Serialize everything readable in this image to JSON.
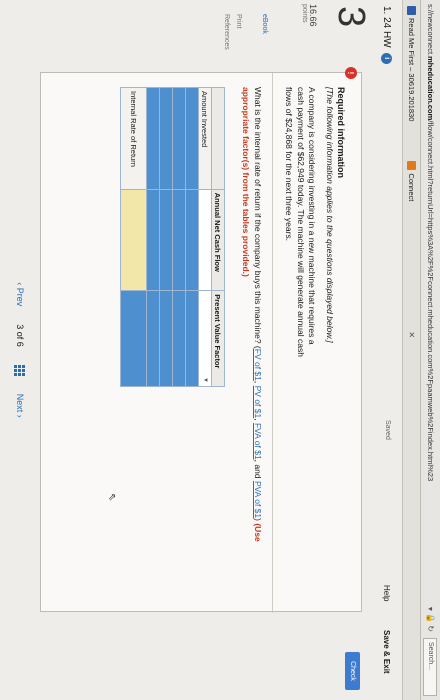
{
  "browser": {
    "url_host": "mheducation.com",
    "url_prefix": "s://newconnect.",
    "url_rest": "/flow/connect.html?returnUrl=https%3A%2F%2Fconnect.mheducation.com%2Fpaamweb%2Findex.html%23 ",
    "search_placeholder": "Search...",
    "bookmarks": [
      {
        "label": "Read Me First – 30619.201830",
        "icon": "book-icon",
        "color": "#2f5da8"
      },
      {
        "label": "Connect",
        "icon": "connect-icon",
        "color": "#e07a1f"
      }
    ]
  },
  "header": {
    "title": "1. 24 HW",
    "saved": "Saved",
    "help": "Help",
    "save_exit": "Save & Exit",
    "check": "Check"
  },
  "rail": {
    "question_number": "3",
    "points_value": "16.66",
    "points_label": "points",
    "links": [
      "eBook",
      "Print",
      "References"
    ]
  },
  "content": {
    "required_title": "Required information",
    "required_note": "[The following information applies to the questions displayed below.]",
    "required_body": "A company is considering investing in a new machine that requires a cash payment of $62,949 today. The machine will generate annual cash flows of $24,868 for the next three years.",
    "question_text": "What is the internal rate of return if the company buys this machine?",
    "links": [
      "FV of $1",
      "PV of $1",
      "FVA of $1",
      "PVA of $1"
    ],
    "instruction": "(Use appropriate factor(s) from the tables provided.)"
  },
  "table": {
    "headers": [
      "",
      "Annual Net Cash Flow",
      "Present Value Factor"
    ],
    "row_labels": [
      "Amount Invested",
      "Internal Rate of Return"
    ]
  },
  "pager": {
    "prev": "Prev",
    "position": "3",
    "of": "of 6",
    "next": "Next"
  }
}
